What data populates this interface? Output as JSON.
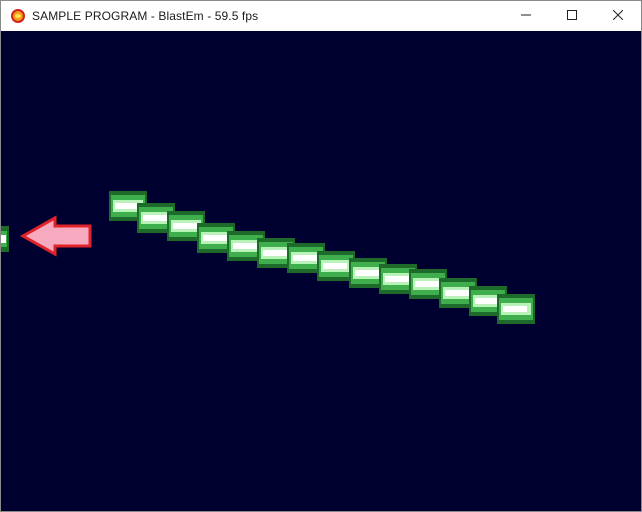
{
  "window": {
    "title": "SAMPLE PROGRAM - BlastEm - 59.5 fps",
    "icon": "blastem-app-icon",
    "controls": [
      "minimize-icon",
      "maximize-icon",
      "close-icon"
    ]
  },
  "game": {
    "background_color": "#000030",
    "elements": [
      "laser-segment",
      "arrow-sprite"
    ],
    "colors": {
      "laser_dark": "#1d6a2a",
      "laser_mid": "#3fae4c",
      "laser_light": "#b9f2b8",
      "laser_core": "#ffffff",
      "arrow_fill": "#f7aabf",
      "arrow_outline": "#e0242a"
    }
  }
}
